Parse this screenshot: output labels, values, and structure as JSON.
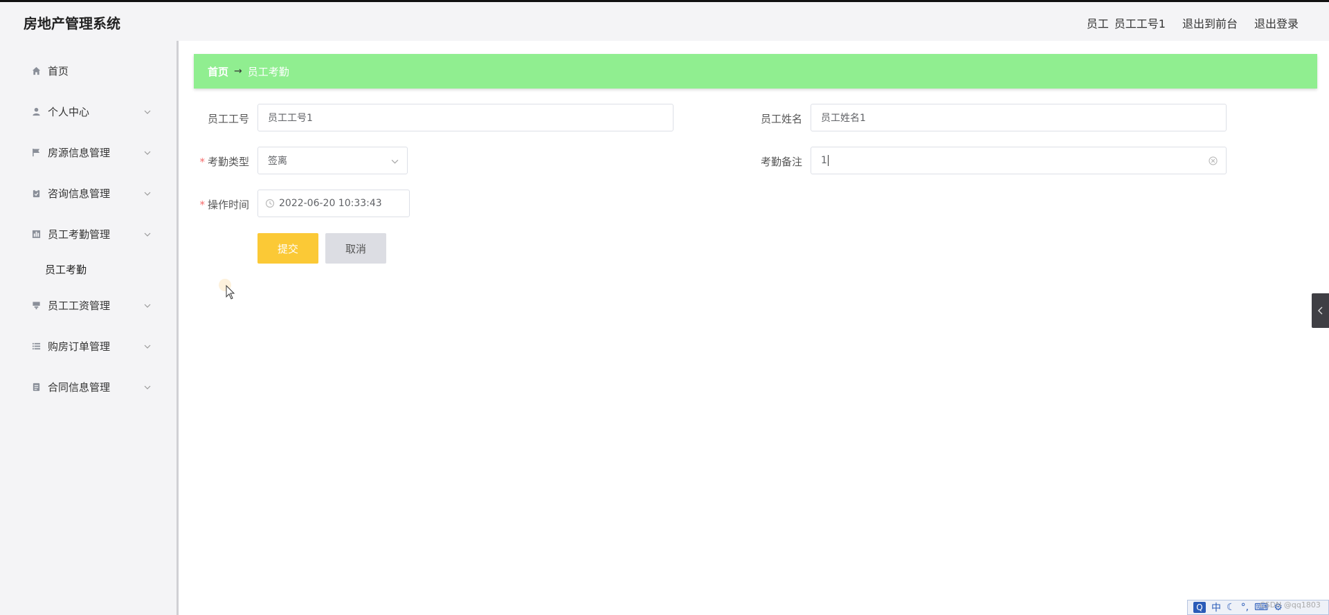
{
  "header": {
    "title": "房地产管理系统",
    "role": "员工",
    "username": "员工工号1",
    "to_front_label": "退出到前台",
    "logout_label": "退出登录"
  },
  "sidebar": {
    "items": [
      {
        "label": "首页",
        "icon": "home-icon"
      },
      {
        "label": "个人中心",
        "icon": "user-icon"
      },
      {
        "label": "房源信息管理",
        "icon": "flag-icon"
      },
      {
        "label": "咨询信息管理",
        "icon": "clipboard-icon"
      },
      {
        "label": "员工考勤管理",
        "icon": "chart-icon"
      },
      {
        "label": "员工工资管理",
        "icon": "goods-icon"
      },
      {
        "label": "购房订单管理",
        "icon": "list-icon"
      },
      {
        "label": "合同信息管理",
        "icon": "document-icon"
      }
    ],
    "subitem": "员工考勤"
  },
  "breadcrumb": {
    "home": "首页",
    "separator": "→",
    "current": "员工考勤"
  },
  "form": {
    "emp_no_label": "员工工号",
    "emp_no_value": "员工工号1",
    "emp_name_label": "员工姓名",
    "emp_name_value": "员工姓名1",
    "type_label": "考勤类型",
    "type_value": "签离",
    "remark_label": "考勤备注",
    "remark_value": "1",
    "time_label": "操作时间",
    "time_value": "2022-06-20 10:33:43",
    "required_mark": "*"
  },
  "buttons": {
    "submit": "提交",
    "cancel": "取消"
  },
  "ime": {
    "lang": "中"
  },
  "watermark": "CSDN @qq1803",
  "colors": {
    "banner": "#90ee90",
    "submit": "#fbc936",
    "cancel": "#dcdde3",
    "sidebar": "#f4f4f6"
  }
}
